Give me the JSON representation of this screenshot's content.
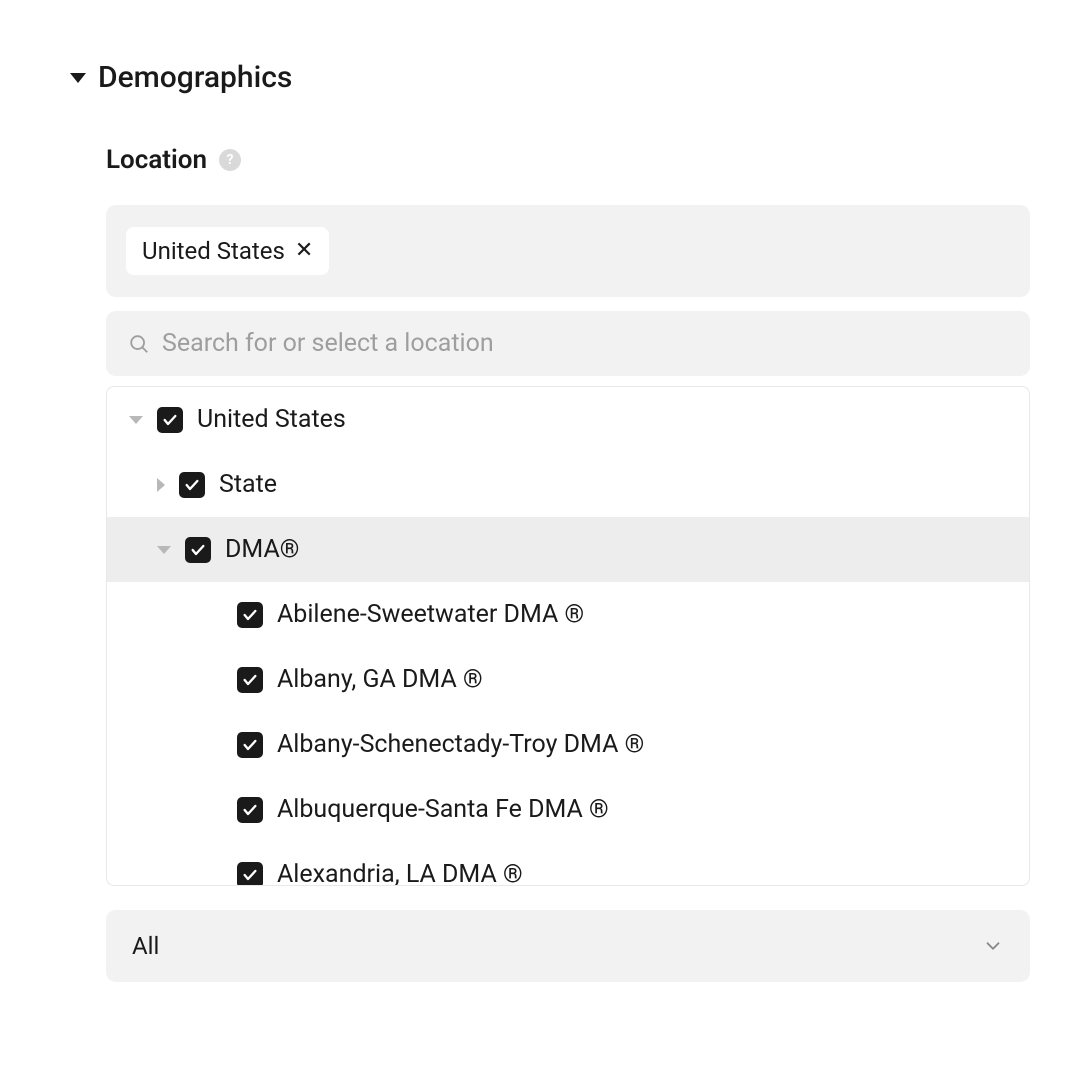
{
  "section": {
    "title": "Demographics"
  },
  "location": {
    "label": "Location",
    "help_symbol": "?",
    "selected_chips": [
      {
        "label": "United States"
      }
    ],
    "search_placeholder": "Search for or select a location",
    "tree": {
      "root": {
        "label": "United States",
        "checked": true,
        "expanded": true,
        "children": [
          {
            "label": "State",
            "checked": true,
            "expanded": false,
            "children": []
          },
          {
            "label": "DMA®",
            "checked": true,
            "expanded": true,
            "highlighted": true,
            "children": [
              {
                "label": "Abilene-Sweetwater DMA ®",
                "checked": true
              },
              {
                "label": "Albany, GA DMA ®",
                "checked": true
              },
              {
                "label": "Albany-Schenectady-Troy DMA ®",
                "checked": true
              },
              {
                "label": "Albuquerque-Santa Fe DMA ®",
                "checked": true
              },
              {
                "label": "Alexandria, LA DMA ®",
                "checked": true
              }
            ]
          }
        ]
      }
    },
    "dropdown": {
      "value": "All"
    }
  }
}
